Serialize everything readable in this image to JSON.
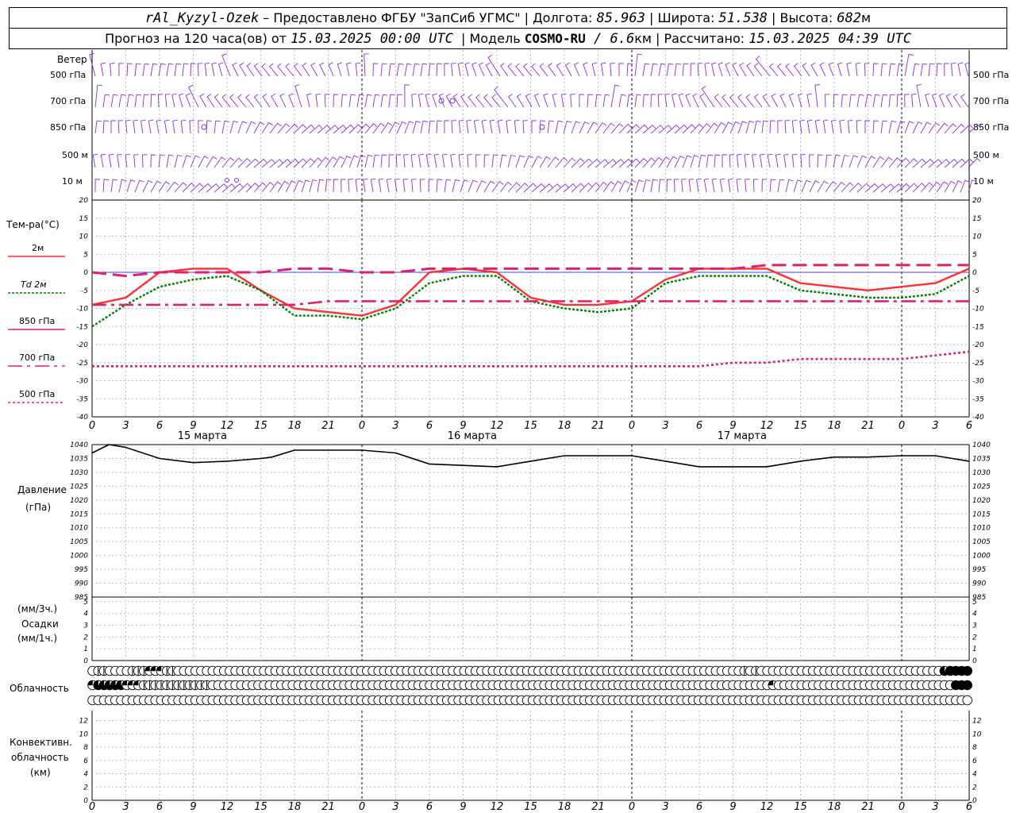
{
  "header": {
    "station": "rAl_Kyzyl-Ozek",
    "provider": " – Предоставлено ФГБУ \"ЗапСиб УГМС\" | Долгота: ",
    "lon": "85.963",
    "lat_label": " | Широта: ",
    "lat": "51.538",
    "alt_label": " | Высота: ",
    "alt": "682",
    "alt_unit": "м",
    "forecast_label": "Прогноз на 120 часа(ов) от ",
    "forecast_start": "15.03.2025 00:00 UTC",
    "model_label": "  | Модель ",
    "model": "COSMO-RU",
    "model_res": " / 6.6",
    "res_unit": "км",
    "calc_label": " | Рассчитано: ",
    "calc_time": "15.03.2025 04:39 UTC"
  },
  "panels": {
    "wind": {
      "title": "Ветер",
      "levels": [
        "500 гПа",
        "700 гПа",
        "850 гПа",
        "500 м",
        "10  м"
      ]
    },
    "temp": {
      "title": "Тем-ра(°С)",
      "legend": [
        {
          "label": "2м",
          "color": "#ff2020"
        },
        {
          "label": "Td  2м",
          "color": "#008000"
        },
        {
          "label": "850 гПа",
          "color": "#e0206a"
        },
        {
          "label": "700 гПа",
          "color": "#e0206a"
        },
        {
          "label": "500 гПа",
          "color": "#e0206a"
        }
      ]
    },
    "pressure": {
      "title": "Давление",
      "unit": "(гПа)"
    },
    "precip": {
      "unit1": "(мм/3ч.)",
      "title": "Осадки",
      "unit2": "(мм/1ч.)"
    },
    "cloud": {
      "title": "Облачность"
    },
    "conv": {
      "line1": "Конвективн.",
      "line2": "облачность",
      "unit": "(км)"
    }
  },
  "colors": {
    "wind": "#8a2be2",
    "t2m": "#ff3030",
    "td": "#008000",
    "upper": "#e0206a",
    "grid": "#aaaaaa",
    "zero": "#4040ff"
  },
  "chart_data": [
    {
      "type": "line",
      "title": "Тем-ра(°С)",
      "x_hours": [
        0,
        3,
        6,
        9,
        12,
        15,
        18,
        21,
        24,
        27,
        30,
        33,
        36,
        39,
        42,
        45,
        48,
        51,
        54,
        57,
        60,
        63,
        66,
        69,
        72,
        75,
        78
      ],
      "x_tick_labels": [
        "0",
        "3",
        "6",
        "9",
        "12",
        "15",
        "18",
        "21",
        "0",
        "3",
        "6",
        "9",
        "12",
        "15",
        "18",
        "21",
        "0",
        "3",
        "6",
        "9",
        "12",
        "15",
        "18",
        "21",
        "0",
        "3",
        "6"
      ],
      "day_labels": [
        "15 марта",
        "16 марта",
        "17 марта"
      ],
      "ylim": [
        -40,
        20
      ],
      "yticks": [
        -40,
        -35,
        -30,
        -25,
        -20,
        -15,
        -10,
        -5,
        0,
        5,
        10,
        15,
        20
      ],
      "series": [
        {
          "name": "2м",
          "values": [
            -9,
            -7,
            0,
            1,
            1,
            -5,
            -10,
            -11,
            -12,
            -9,
            0,
            1,
            0,
            -7,
            -9,
            -9,
            -8,
            -2,
            1,
            1,
            1,
            -3,
            -4,
            -5,
            -4,
            -3,
            1
          ]
        },
        {
          "name": "Td  2м",
          "values": [
            -15,
            -9,
            -4,
            -2,
            -1,
            -5,
            -12,
            -12,
            -13,
            -10,
            -3,
            -1,
            -1,
            -8,
            -10,
            -11,
            -10,
            -3,
            -1,
            -1,
            -1,
            -5,
            -6,
            -7,
            -7,
            -6,
            -1
          ]
        },
        {
          "name": "850 гПа",
          "values": [
            0,
            -1,
            0,
            0,
            0,
            0,
            1,
            1,
            0,
            0,
            1,
            1,
            1,
            1,
            1,
            1,
            1,
            1,
            1,
            1,
            2,
            2,
            2,
            2,
            2,
            2,
            2
          ]
        },
        {
          "name": "700 гПа",
          "values": [
            -9,
            -9,
            -9,
            -9,
            -9,
            -9,
            -9,
            -8,
            -8,
            -8,
            -8,
            -8,
            -8,
            -8,
            -8,
            -8,
            -8,
            -8,
            -8,
            -8,
            -8,
            -8,
            -8,
            -8,
            -8,
            -8,
            -8
          ]
        },
        {
          "name": "500 гПа",
          "values": [
            -26,
            -26,
            -26,
            -26,
            -26,
            -26,
            -26,
            -26,
            -26,
            -26,
            -26,
            -26,
            -26,
            -26,
            -26,
            -26,
            -26,
            -26,
            -26,
            -25,
            -25,
            -24,
            -24,
            -24,
            -24,
            -23,
            -22
          ]
        }
      ]
    },
    {
      "type": "line",
      "title": "Давление",
      "x_hours": [
        0,
        1.5,
        3,
        6,
        9,
        12,
        15,
        16,
        18,
        21,
        24,
        27,
        30,
        33,
        36,
        39,
        42,
        45,
        48,
        51,
        54,
        57,
        60,
        63,
        66,
        69,
        72,
        75,
        78
      ],
      "ylim": [
        985,
        1040
      ],
      "yticks": [
        985,
        990,
        995,
        1000,
        1005,
        1010,
        1015,
        1020,
        1025,
        1030,
        1035,
        1040
      ],
      "series": [
        {
          "values": [
            1037,
            1040,
            1039,
            1035,
            1033.5,
            1034,
            1035,
            1035.5,
            1038,
            1038,
            1038,
            1037,
            1033,
            1032.5,
            1032,
            1034,
            1036,
            1036,
            1036,
            1034,
            1032,
            1032,
            1032,
            1034,
            1035.5,
            1035.5,
            1036,
            1036,
            1034
          ]
        }
      ]
    },
    {
      "type": "bar",
      "title": "Осадки",
      "ylim": [
        0,
        5
      ],
      "yticks": [
        0,
        1,
        2,
        3,
        4,
        5
      ],
      "values": []
    },
    {
      "type": "heatmap",
      "title": "Облачность",
      "rows": [
        "0110000111222110000000000000000000000000000000000000000000000000000000000000000000000000000000000000000000000000001010000000000000000000000000000000034444",
        "2333332221111111111110000000000000000000000000000000000000000000000000000000000000000000000000000000000000000000000000020000000000000000000000000000000444",
        "0000000000000000000000000000000000000000000000000000000000000000000000000000000000000000000000000000000000000000000000000000000000000000000000000000000000"
      ]
    },
    {
      "type": "bar",
      "title": "Конвективн. облачность",
      "ylim": [
        0,
        12
      ],
      "yticks": [
        0,
        2,
        4,
        6,
        8,
        10,
        12
      ],
      "values": []
    }
  ]
}
